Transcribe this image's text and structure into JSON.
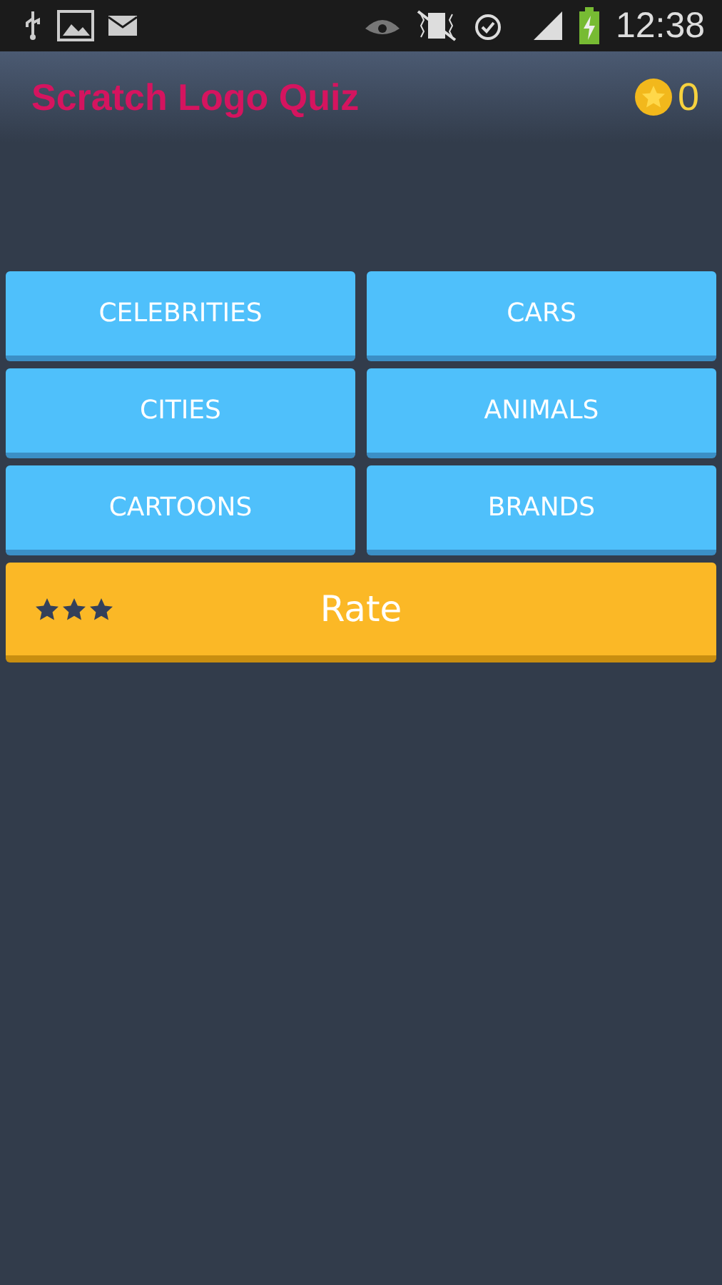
{
  "status_bar": {
    "time": "12:38"
  },
  "app_bar": {
    "title": "Scratch Logo Quiz",
    "coins": "0"
  },
  "categories": [
    {
      "label": "CELEBRITIES"
    },
    {
      "label": "CARS"
    },
    {
      "label": "CITIES"
    },
    {
      "label": "ANIMALS"
    },
    {
      "label": "CARTOONS"
    },
    {
      "label": "BRANDS"
    }
  ],
  "rate_button": {
    "label": "Rate"
  }
}
